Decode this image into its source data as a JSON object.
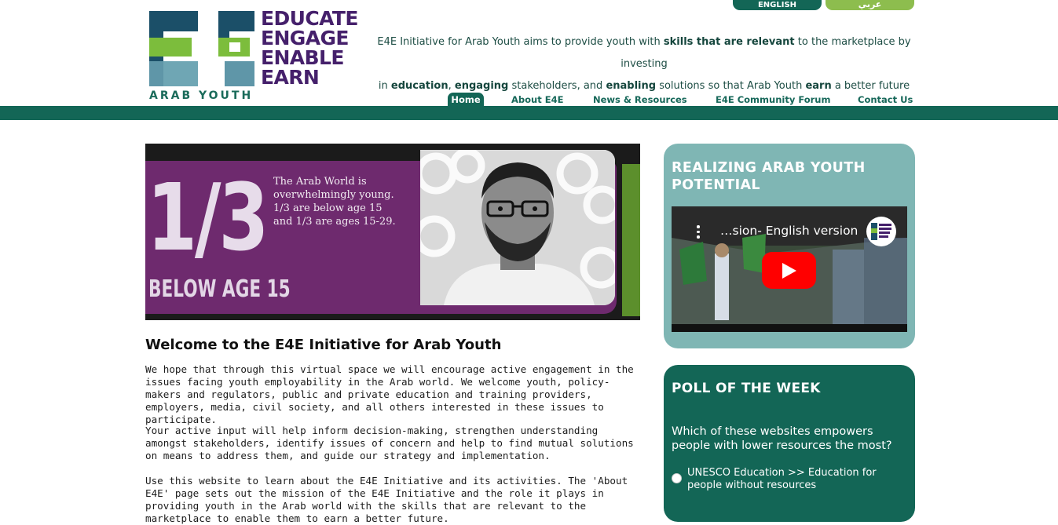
{
  "header": {
    "logo_words": [
      "EDUCATE",
      "ENGAGE",
      "ENABLE",
      "EARN"
    ],
    "logo_tagline": "ARAB YOUTH",
    "lang_english": "ENGLISH",
    "lang_arabic": "عربي",
    "tagline_parts": [
      "E4E Initiative for Arab Youth aims to provide youth with ",
      "skills that are relevant",
      " to the marketplace by investing",
      "in ",
      "education",
      ", ",
      "engaging",
      " stakeholders, and ",
      "enabling",
      " solutions so that Arab Youth ",
      "earn",
      " a better future"
    ]
  },
  "nav": {
    "items": [
      "Home",
      "About E4E",
      "News & Resources",
      "E4E Community Forum",
      "Contact Us"
    ]
  },
  "banner": {
    "big_text": "1/3",
    "sub_text": "BELOW AGE 15",
    "body": [
      "The Arab World is",
      "overwhelmingly young.",
      "1/3 are below age 15",
      "and 1/3 are ages 15-29."
    ]
  },
  "main": {
    "title": "Welcome to the E4E Initiative for Arab Youth",
    "paragraphs": [
      "We hope that through this virtual space we will encourage active engagement in the issues facing youth employability in the Arab world. We welcome youth, policy-makers and regulators, public and private education and training providers, employers, media, civil society, and all others interested in these issues to participate.",
      "Your active input will help inform decision-making, strengthen understanding amongst stakeholders, identify issues of concern and help to find mutual solutions on means to address them, and guide our strategy and implementation.",
      "Use this website to learn about the E4E Initiative and its activities. The 'About E4E' page sets out the mission of the E4E Initiative and the role it plays in providing youth in the Arab world with the skills that are relevant to the marketplace to enable them to earn a better future."
    ]
  },
  "video_widget": {
    "title": "REALIZING ARAB YOUTH POTENTIAL",
    "video_title": "…sion- English version"
  },
  "poll": {
    "title": "POLL OF THE WEEK",
    "question": "Which of these websites empowers people with lower resources the most?",
    "options": [
      "UNESCO Education >> Education for people without resources"
    ]
  },
  "colors": {
    "brand_green": "#136656",
    "light_green": "#8dbd4e",
    "teal_box": "#7fb6b4",
    "purple": "#6e2a6e",
    "logo_purple": "#45206b"
  }
}
